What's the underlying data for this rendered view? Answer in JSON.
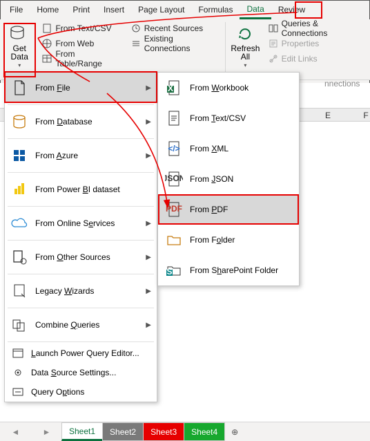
{
  "tabs": {
    "file": "File",
    "home": "Home",
    "print": "Print",
    "insert": "Insert",
    "page": "Page Layout",
    "form": "Formulas",
    "data": "Data",
    "review": "Review"
  },
  "ribbon": {
    "getdata": "Get\nData",
    "textcsv": "From Text/CSV",
    "web": "From Web",
    "range": "From Table/Range",
    "recent": "Recent Sources",
    "existing": "Existing Connections",
    "refresh": "Refresh\nAll",
    "queries": "Queries & Connections",
    "props": "Properties",
    "links": "Edit Links",
    "grp_queries_tail": "nnections"
  },
  "menuA": {
    "file": "From File",
    "db": "From Database",
    "azure": "From Azure",
    "pbi": "From Power BI dataset",
    "online": "From Online Services",
    "other": "From Other Sources",
    "legacy": "Legacy Wizards",
    "combine": "Combine Queries",
    "launch": "Launch Power Query Editor...",
    "ds": "Data Source Settings...",
    "opts": "Query Options"
  },
  "menuB": {
    "wb": "From Workbook",
    "txt": "From Text/CSV",
    "xml": "From XML",
    "json": "From JSON",
    "pdf": "From PDF",
    "folder": "From Folder",
    "sp": "From SharePoint Folder"
  },
  "cols": {
    "e": "E",
    "f": "F"
  },
  "sheets": {
    "s1": "Sheet1",
    "s2": "Sheet2",
    "s3": "Sheet3",
    "s4": "Sheet4"
  },
  "icons": {}
}
